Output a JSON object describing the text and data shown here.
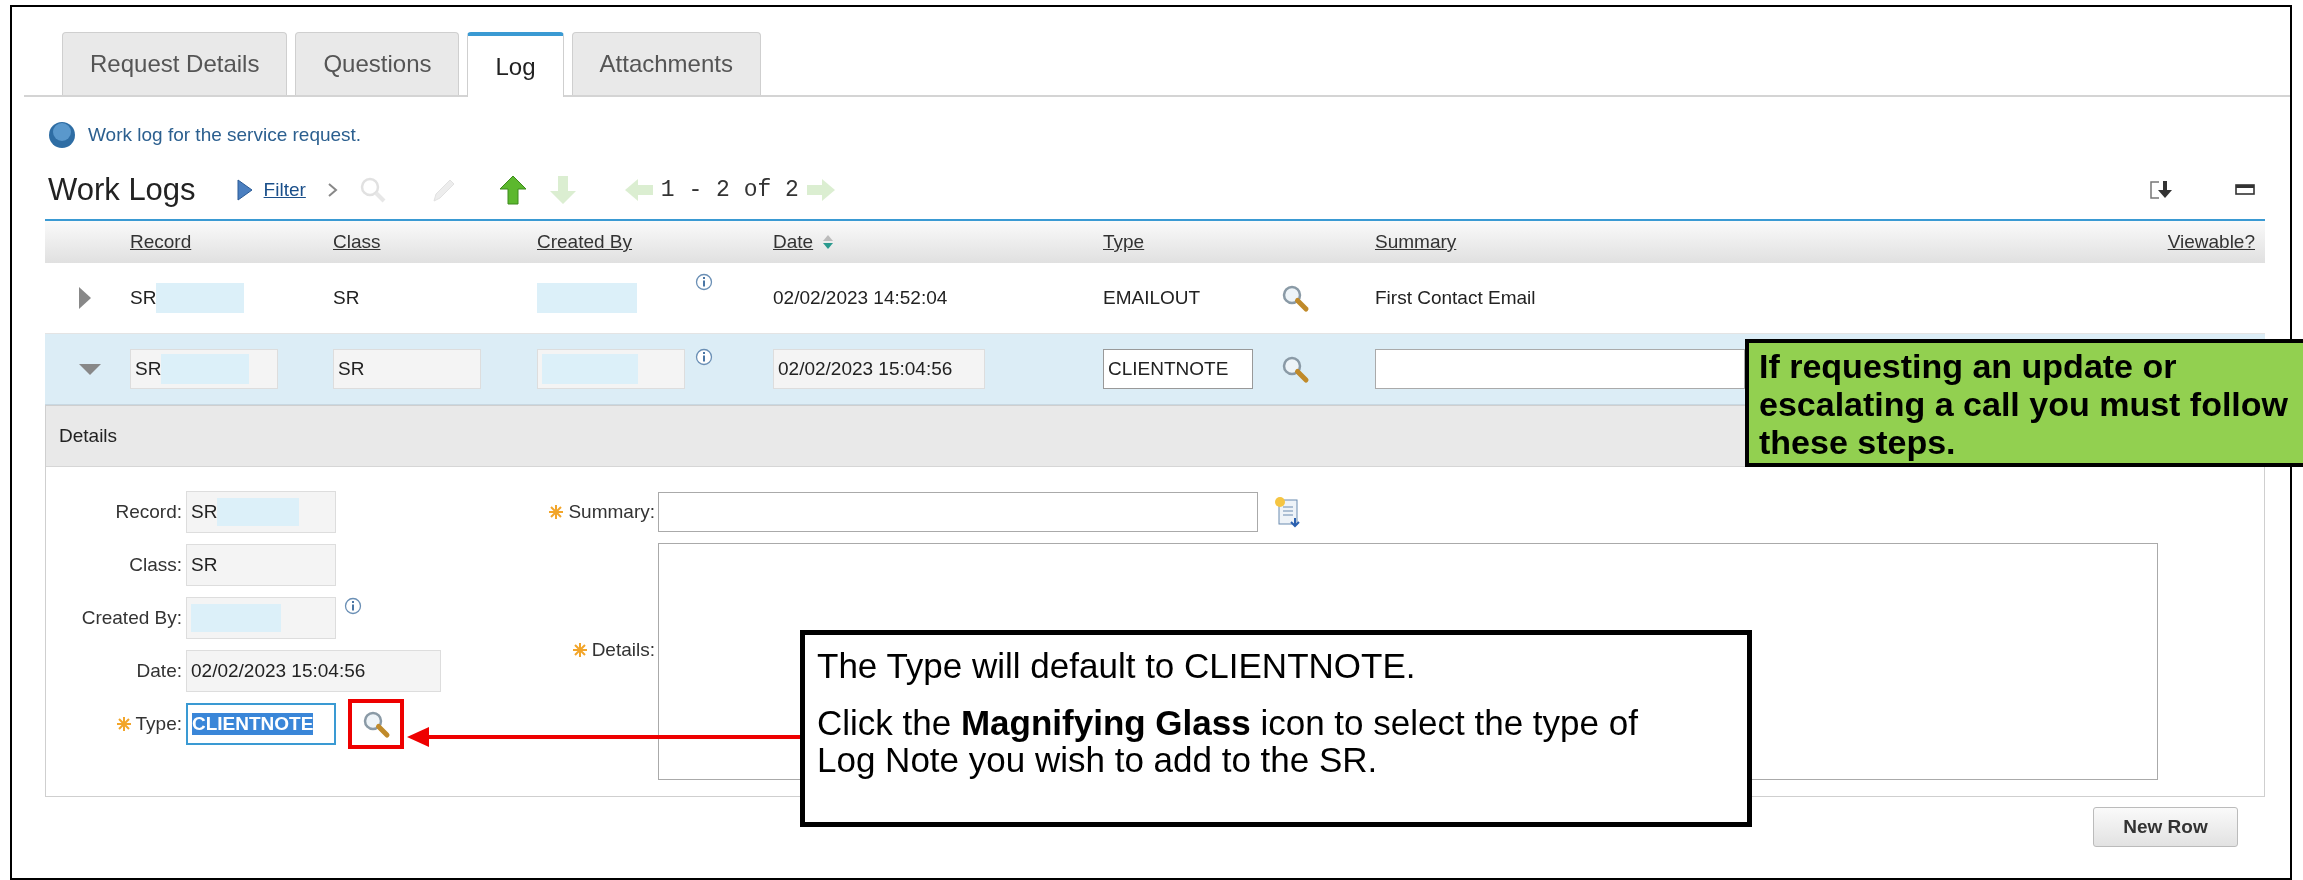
{
  "tabs": [
    {
      "label": "Request Details",
      "selected": false
    },
    {
      "label": "Questions",
      "selected": false
    },
    {
      "label": "Log",
      "selected": true
    },
    {
      "label": "Attachments",
      "selected": false
    }
  ],
  "help_text": "Work log for the service request.",
  "section": {
    "title": "Work Logs",
    "filter_label": "Filter",
    "pager": "1 - 2 of 2"
  },
  "table": {
    "columns": [
      {
        "label": "Record",
        "sorted": false
      },
      {
        "label": "Class",
        "sorted": false
      },
      {
        "label": "Created By",
        "sorted": false
      },
      {
        "label": "Date",
        "sorted": true
      },
      {
        "label": "Type",
        "sorted": false
      },
      {
        "label": "Summary",
        "sorted": false
      },
      {
        "label": "Viewable?",
        "sorted": false
      }
    ],
    "rows": [
      {
        "expanded": false,
        "record": "SR",
        "class": "SR",
        "date": "02/02/2023 14:52:04",
        "type": "EMAILOUT",
        "summary": "First Contact Email"
      },
      {
        "expanded": true,
        "record": "SR",
        "class": "SR",
        "date": "02/02/2023 15:04:56",
        "type": "CLIENTNOTE"
      }
    ]
  },
  "details": {
    "title": "Details",
    "fields": [
      {
        "kind": "text",
        "label": "Record:",
        "value": "SR",
        "required": false,
        "info": false
      },
      {
        "kind": "text",
        "label": "Class:",
        "value": "SR",
        "required": false,
        "info": false
      },
      {
        "kind": "text",
        "label": "Created By:",
        "required": false,
        "info": true
      },
      {
        "kind": "text",
        "label": "Date:",
        "value": "02/02/2023 15:04:56",
        "required": false,
        "info": false
      },
      {
        "kind": "lookup",
        "label": "Type:",
        "value": "CLIENTNOTE",
        "required": true,
        "info": false
      }
    ],
    "summary": {
      "label": "Summary:",
      "required": true
    },
    "details_field": {
      "label": "Details:",
      "required": true
    }
  },
  "new_row_button": "New Row",
  "callouts": [
    {
      "kind": "instruction",
      "paragraphs": [
        "The Type will default to CLIENTNOTE.",
        "Click the **Magnifying Glass** icon to select the type of Log Note you wish to add to the SR."
      ]
    },
    {
      "kind": "warning",
      "text": "If requesting an update or escalating a call you must follow these steps."
    }
  ]
}
